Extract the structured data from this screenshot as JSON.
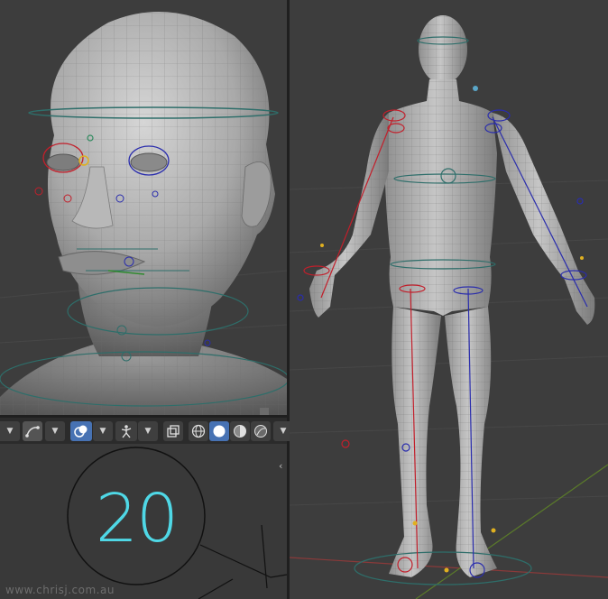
{
  "toolbar": {
    "items": [
      {
        "name": "snap-chevron",
        "icon": "chevron-down-icon"
      },
      {
        "name": "proportional-editing",
        "icon": "curve-icon"
      },
      {
        "name": "overlay-toggle",
        "icon": "overlay-icon",
        "active": true
      },
      {
        "name": "pose-toggle",
        "icon": "armature-pose-icon"
      },
      {
        "name": "xray-toggle",
        "icon": "xray-icon"
      },
      {
        "name": "shading-wireframe",
        "icon": "wireframe-sphere-icon"
      },
      {
        "name": "shading-solid",
        "icon": "solid-sphere-icon",
        "active": true
      },
      {
        "name": "shading-material",
        "icon": "material-sphere-icon"
      },
      {
        "name": "shading-rendered",
        "icon": "rendered-sphere-icon"
      }
    ]
  },
  "frame_counter": {
    "value": "20"
  },
  "watermark": {
    "text": "www.chrisj.com.au"
  },
  "colors": {
    "background": "#3d3d3d",
    "mesh": "#c9c9c9",
    "wire": "#6a6a6a",
    "bone_left": "#c21f2b",
    "bone_right": "#2a2dad",
    "control_teal": "#2e6e6a",
    "accent_blue": "#4772b3",
    "frame_text": "#4fd8e6"
  }
}
